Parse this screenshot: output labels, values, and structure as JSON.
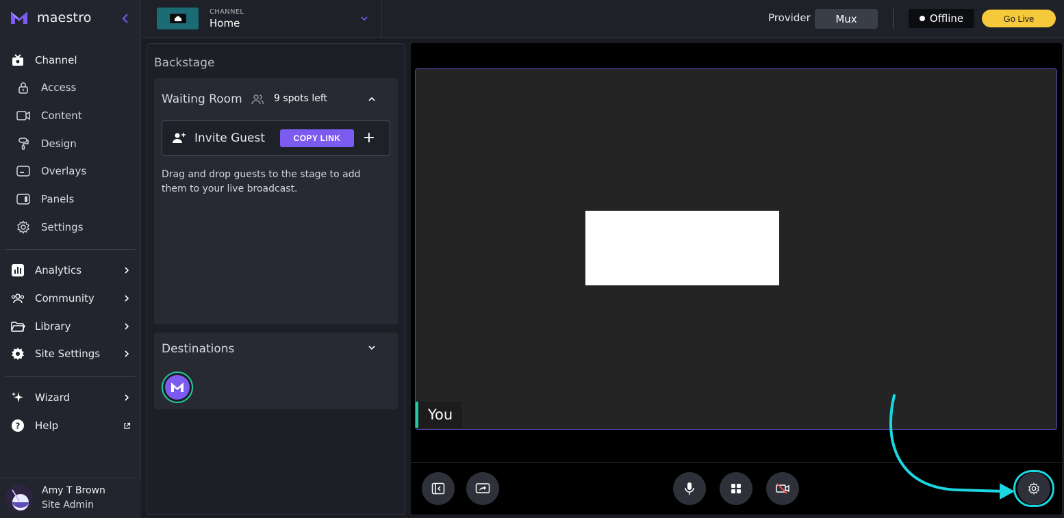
{
  "brand": {
    "name": "maestro"
  },
  "sidebar": {
    "channel_label": "Channel",
    "channel_items": [
      {
        "label": "Access",
        "icon": "lock-icon"
      },
      {
        "label": "Content",
        "icon": "video-camera-icon"
      },
      {
        "label": "Design",
        "icon": "paint-roller-icon"
      },
      {
        "label": "Overlays",
        "icon": "overlay-icon"
      },
      {
        "label": "Panels",
        "icon": "panel-icon"
      },
      {
        "label": "Settings",
        "icon": "gear-icon"
      }
    ],
    "sections": [
      {
        "label": "Analytics",
        "icon": "bar-chart-icon"
      },
      {
        "label": "Community",
        "icon": "users-icon"
      },
      {
        "label": "Library",
        "icon": "folder-icon"
      },
      {
        "label": "Site Settings",
        "icon": "cog-solid-icon"
      }
    ],
    "extras": [
      {
        "label": "Wizard",
        "icon": "sparkle-icon"
      },
      {
        "label": "Help",
        "icon": "question-circle-icon"
      }
    ],
    "user": {
      "name": "Amy T Brown",
      "role": "Site Admin"
    }
  },
  "topbar": {
    "channel_kicker": "CHANNEL",
    "channel_name": "Home",
    "provider_label": "Provider",
    "provider_value": "Mux",
    "status": "Offline",
    "go_live": "Go Live"
  },
  "backstage": {
    "title": "Backstage",
    "waiting_room": {
      "title": "Waiting Room",
      "spots": "9 spots left",
      "invite_label": "Invite Guest",
      "copy_link": "COPY LINK",
      "add": "+",
      "help": "Drag and drop guests to the stage to add them to your live broadcast."
    },
    "destinations": {
      "title": "Destinations"
    }
  },
  "stage": {
    "participant_name": "You"
  },
  "colors": {
    "accent": "#7c5cf0",
    "go_live": "#f5c93a",
    "highlight": "#1ad7e2",
    "live_green": "#23c9a0"
  }
}
